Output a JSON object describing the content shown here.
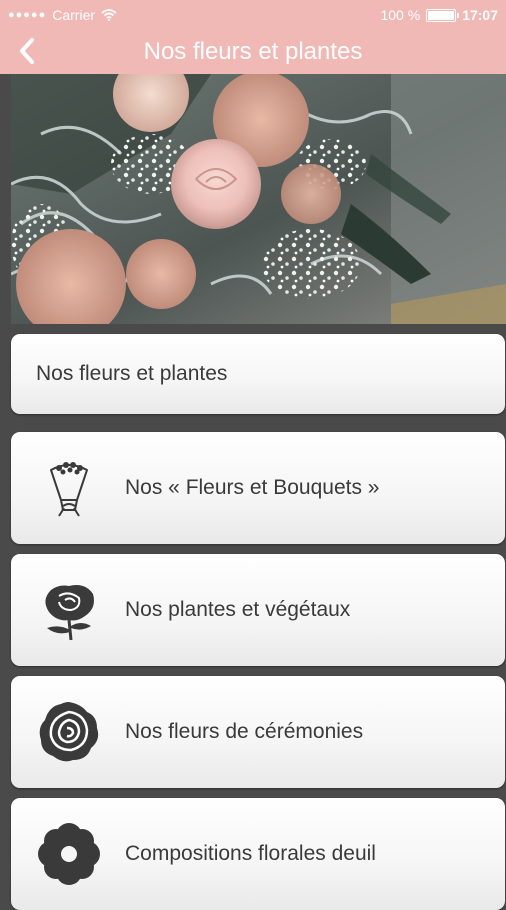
{
  "status_bar": {
    "signal_dots": "●●●●●",
    "carrier": "Carrier",
    "battery_percent": "100 %",
    "battery_level": 1.0,
    "time": "17:07"
  },
  "nav": {
    "title": "Nos fleurs et plantes",
    "back_icon": "chevron-left-icon"
  },
  "colors": {
    "accent": "#f1b9b6",
    "background": "#4a4a4a",
    "text": "#3a3a3a",
    "icon": "#3a3a3a"
  },
  "menu": {
    "header": "Nos fleurs et plantes",
    "items": [
      {
        "label": "Nos « Fleurs et Bouquets »",
        "icon": "bouquet-icon"
      },
      {
        "label": "Nos plantes et végétaux",
        "icon": "rose-icon"
      },
      {
        "label": "Nos fleurs de cérémonies",
        "icon": "round-rose-icon"
      },
      {
        "label": "Compositions florales deuil",
        "icon": "flower-icon"
      }
    ]
  }
}
